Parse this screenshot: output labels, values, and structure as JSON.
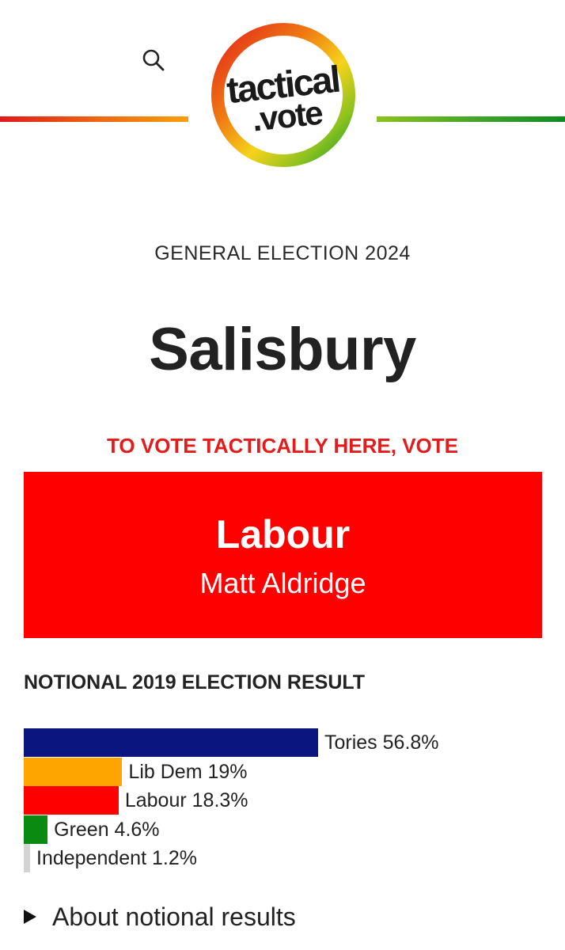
{
  "header": {
    "search_icon": "search-icon",
    "logo": {
      "line1": "tactical",
      "line2": ".vote"
    },
    "line_colors": {
      "left": [
        "#e01a1a",
        "#f5a00f"
      ],
      "right": [
        "#8cc21f",
        "#0f8a1e"
      ]
    }
  },
  "page": {
    "election_label": "GENERAL ELECTION 2024",
    "constituency": "Salisbury",
    "vote_prompt": "TO VOTE TACTICALLY HERE, VOTE"
  },
  "recommendation": {
    "party": "Labour",
    "candidate": "Matt Aldridge",
    "color": "#ff0000"
  },
  "results": {
    "heading": "NOTIONAL 2019 ELECTION RESULT",
    "parties": [
      {
        "name": "Tories",
        "percent": 56.8,
        "label": "Tories 56.8%",
        "color": "#0a1580"
      },
      {
        "name": "Lib Dem",
        "percent": 19,
        "label": "Lib Dem 19%",
        "color": "#ffa500"
      },
      {
        "name": "Labour",
        "percent": 18.3,
        "label": "Labour 18.3%",
        "color": "#ff0000"
      },
      {
        "name": "Green",
        "percent": 4.6,
        "label": "Green 4.6%",
        "color": "#0b8a12"
      },
      {
        "name": "Independent",
        "percent": 1.2,
        "label": "Independent 1.2%",
        "color": "#d3d3d3"
      }
    ]
  },
  "details": {
    "label": "About notional results"
  }
}
